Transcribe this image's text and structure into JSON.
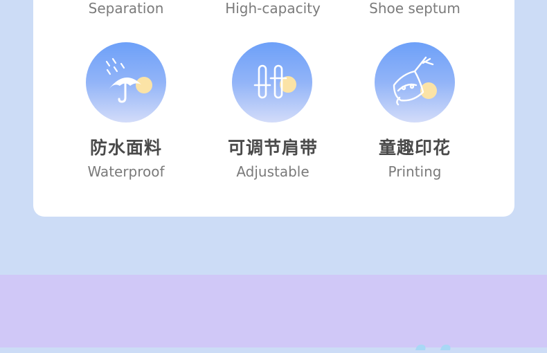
{
  "top_labels": [
    "Separation",
    "High-capacity",
    "Shoe septum"
  ],
  "features": [
    {
      "icon": "umbrella-icon",
      "title_cn": "防水面料",
      "title_en": "Waterproof"
    },
    {
      "icon": "adjustable-strap-icon",
      "title_cn": "可调节肩带",
      "title_en": "Adjustable"
    },
    {
      "icon": "printing-icon",
      "title_cn": "童趣印花",
      "title_en": "Printing"
    }
  ],
  "colors": {
    "background_top": "#ccdcf6",
    "background_bottom": "#d0c8f7",
    "card": "#ffffff",
    "circle_top": "#6da0f8",
    "circle_bottom": "#d3dcf9",
    "accent_dot": "#fbe3a6"
  }
}
